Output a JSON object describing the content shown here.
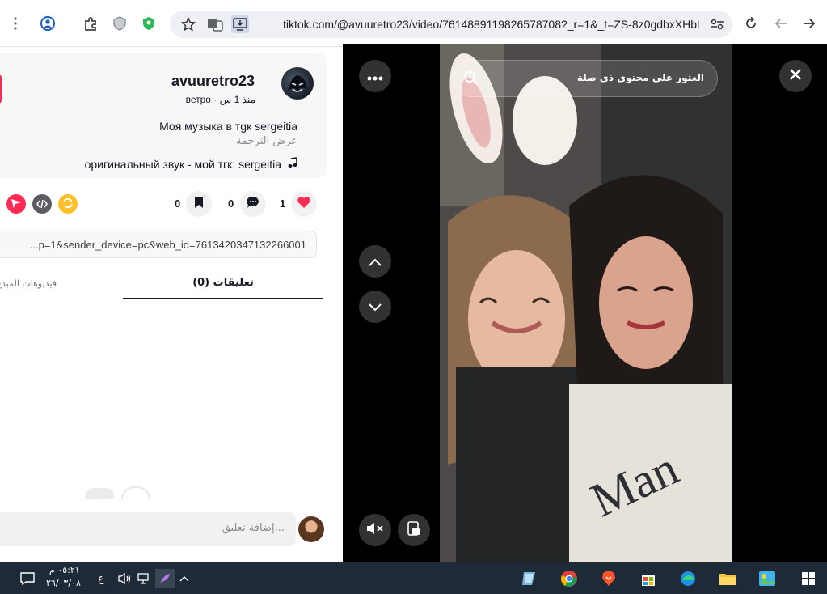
{
  "browser": {
    "url": "tiktok.com/@avuuretro23/video/7614889119826578708?_r=1&_t=ZS-8z0gdbxXHbl"
  },
  "post": {
    "username": "avuuretro23",
    "subline": "ветро · منذ 1 س",
    "description": "Моя музыка в тgк sergeitia",
    "translate_label": "عرض الترجمة",
    "music": "оригинальный звук - мой тгк: sergeitia",
    "likes": "1",
    "comments_count": "0",
    "saves_count": "0",
    "link": "...p=1&sender_device=pc&web_id=7613420347132266001"
  },
  "tabs": {
    "comments": "(0) تعليقات",
    "creator_videos": "فيديوهات المبدع"
  },
  "comment_bar": {
    "placeholder": "إضافة تعليق..."
  },
  "video": {
    "search_placeholder": "العثور على محتوى ذي صلة"
  },
  "taskbar": {
    "time": "٠٥:٢١ م",
    "date": "٢٦/٠٣/٠٨",
    "lang": "ع"
  },
  "colors": {
    "accent": "#fe2c55",
    "taskbar": "#1e2a38"
  }
}
